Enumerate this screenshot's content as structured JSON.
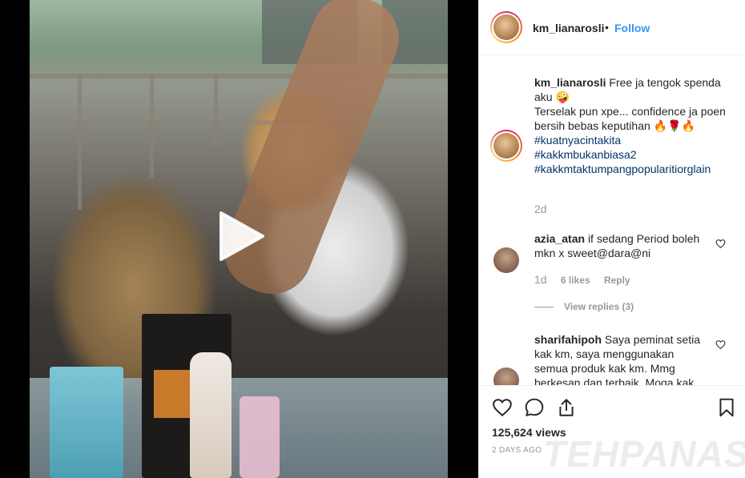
{
  "header": {
    "username": "km_lianarosli",
    "separator": "•",
    "follow_label": "Follow"
  },
  "caption": {
    "username": "km_lianarosli",
    "line1": "Free ja tengok spenda aku 🤪",
    "line2": "Terselak pun xpe... confidence ja poen bersih bebas keputihan 🔥🌹🔥",
    "hashtags": [
      "#kuatnyacintakita",
      "#kakkmbukanbiasa2",
      "#kakkmtaktumpangpopularitiorglain"
    ],
    "time": "2d"
  },
  "comments": [
    {
      "username": "azia_atan",
      "text": "if sedang Period boleh mkn x sweet@dara@ni",
      "time": "1d",
      "likes": "6 likes",
      "reply_label": "Reply",
      "view_replies": "View replies (3)"
    },
    {
      "username": "sharifahipoh",
      "text": "Saya peminat setia kak km, saya menggunakan semua produk kak km. Mmg berkesan dan terbaik. Moga kak"
    }
  ],
  "actions": {
    "views": "125,624 views",
    "posted_ago": "2 DAYS AGO"
  },
  "watermark": "TEHPANAS",
  "icons": {
    "play": "play-icon",
    "like": "heart-icon",
    "comment": "comment-icon",
    "share": "share-icon",
    "save": "bookmark-icon"
  },
  "colors": {
    "link_blue": "#3897f0",
    "hashtag": "#003569",
    "muted": "#999999",
    "text": "#262626"
  }
}
